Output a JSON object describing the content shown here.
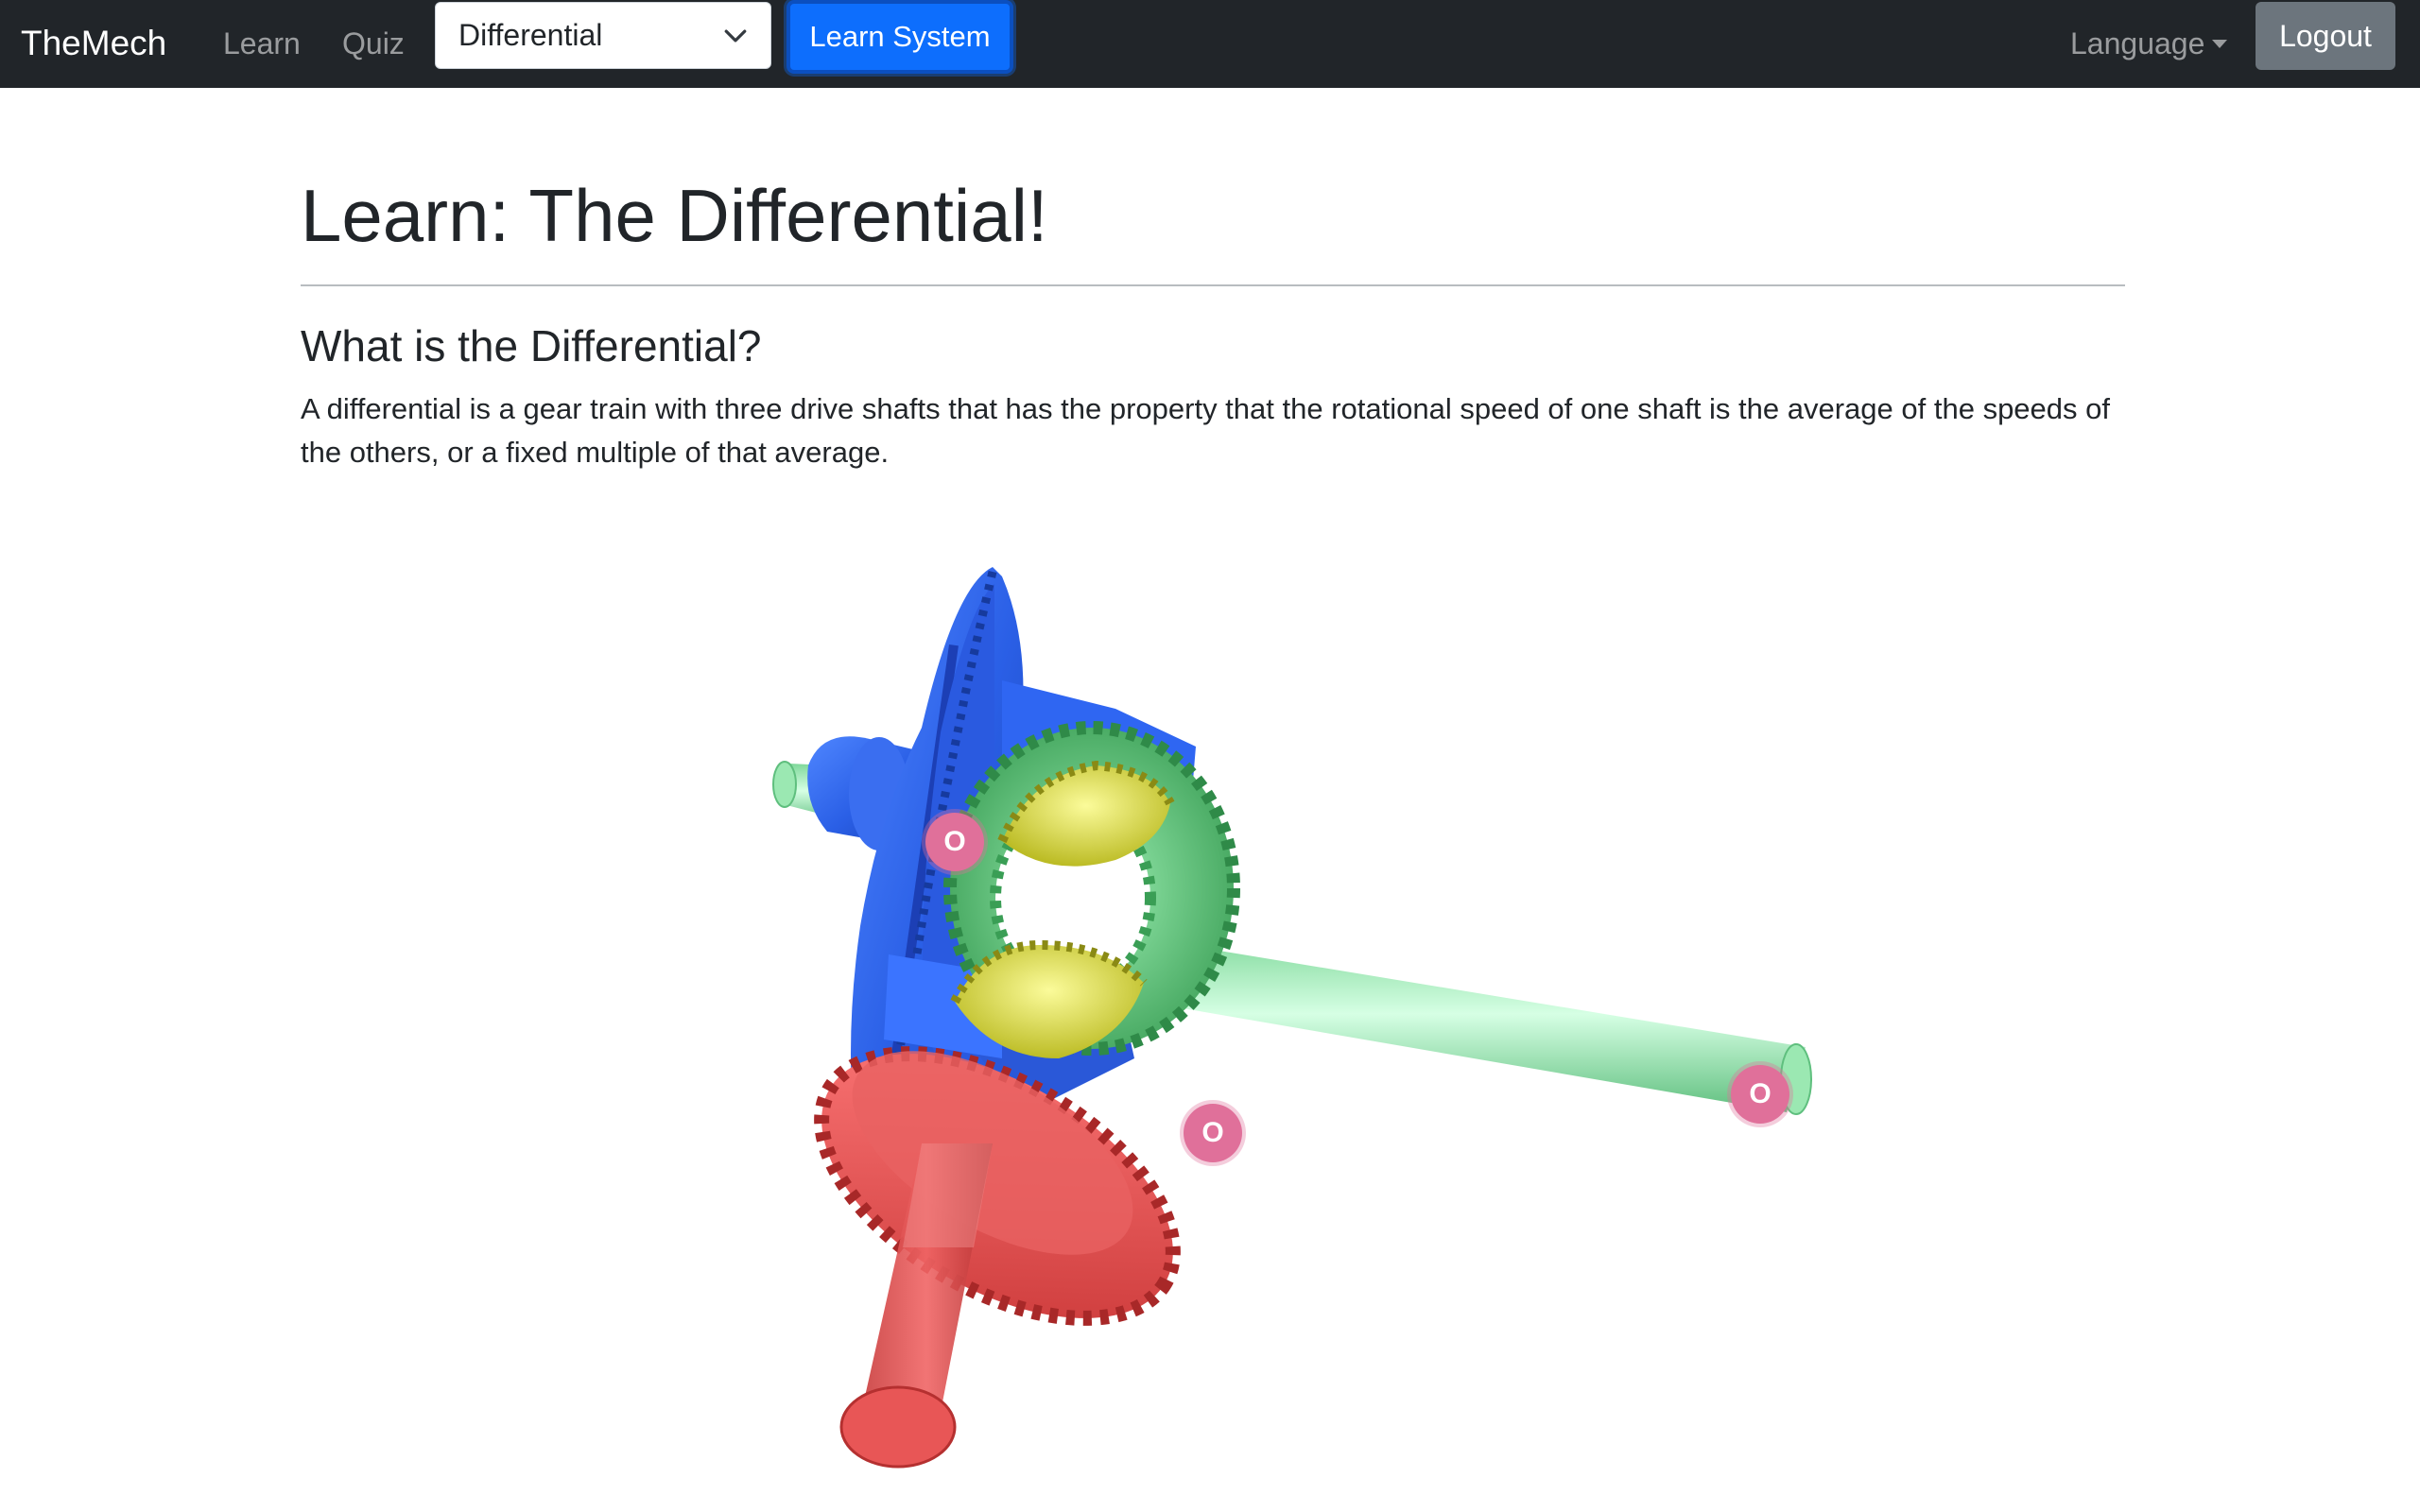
{
  "navbar": {
    "brand": "TheMech",
    "links": {
      "learn": "Learn",
      "quiz": "Quiz"
    },
    "system_select": {
      "selected": "Differential"
    },
    "learn_system_button": "Learn System",
    "language": "Language",
    "logout": "Logout"
  },
  "content": {
    "title": "Learn: The Differential!",
    "section_heading": "What is the Differential?",
    "section_text": "A differential is a gear train with three drive shafts that has the property that the rotational speed of one shaft is the average of the speeds of the others, or a fixed multiple of that average."
  },
  "model_viewer": {
    "hotspots": [
      {
        "id": "left-shaft",
        "label": "O"
      },
      {
        "id": "right-shaft",
        "label": "O"
      },
      {
        "id": "input-gear",
        "label": "O"
      }
    ]
  },
  "colors": {
    "navbar_bg": "#212529",
    "primary": "#0d6efd",
    "secondary": "#6c757d",
    "hotspot": "#e0709a",
    "ring_gear": "#2f5fe0",
    "side_gears": "#4fbf6a",
    "spider_gears": "#d8d838",
    "pinion_gear": "#e25555",
    "shaft": "#8fe0a8"
  }
}
